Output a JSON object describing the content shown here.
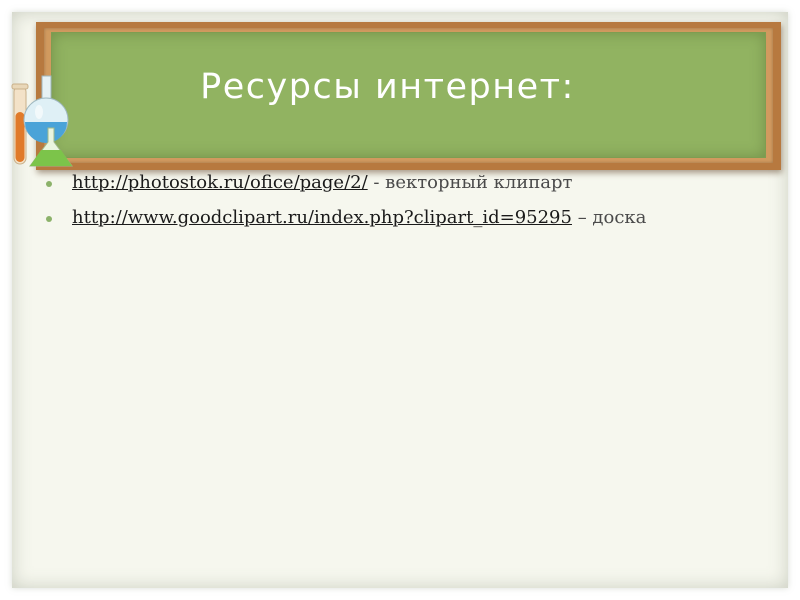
{
  "slide": {
    "title": "Ресурсы интернет:",
    "items": [
      {
        "link": "http://photostok.ru/ofice/page/2/",
        "note": " - векторный клипарт"
      },
      {
        "link": "http://www.goodclipart.ru/index.php?clipart_id=95295",
        "note": " – доска"
      }
    ]
  },
  "colors": {
    "board_frame": "#b7793f",
    "board_surface": "#91b361",
    "bullet": "#8cb26a",
    "background": "#f6f7ee"
  },
  "icons": {
    "flasks": "lab-flasks-icon"
  }
}
